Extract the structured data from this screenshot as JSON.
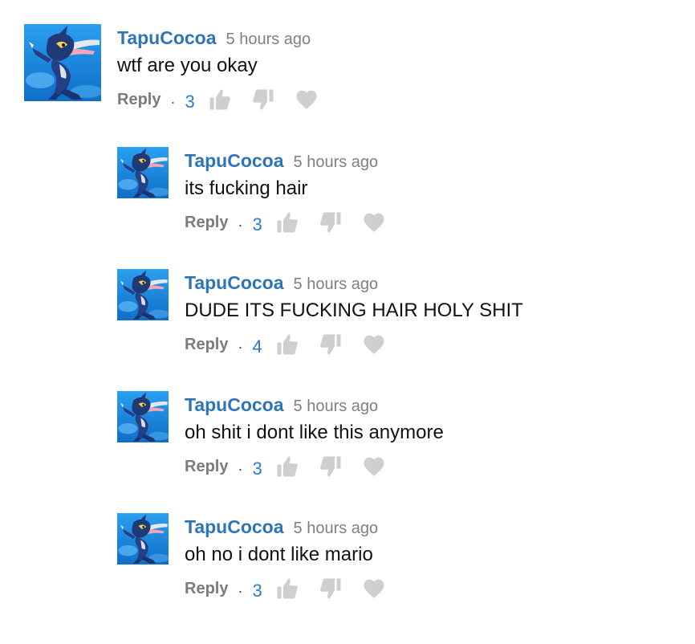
{
  "comments": [
    {
      "author": "TapuCocoa",
      "time": "5 hours ago",
      "text": "wtf are you okay",
      "reply_label": "Reply",
      "separator": "·",
      "likes": "3"
    },
    {
      "author": "TapuCocoa",
      "time": "5 hours ago",
      "text": "its fucking hair",
      "reply_label": "Reply",
      "separator": "·",
      "likes": "3"
    },
    {
      "author": "TapuCocoa",
      "time": "5 hours ago",
      "text": "DUDE ITS FUCKING HAIR HOLY SHIT",
      "reply_label": "Reply",
      "separator": "·",
      "likes": "4"
    },
    {
      "author": "TapuCocoa",
      "time": "5 hours ago",
      "text": "oh shit i dont like this anymore",
      "reply_label": "Reply",
      "separator": "·",
      "likes": "3"
    },
    {
      "author": "TapuCocoa",
      "time": "5 hours ago",
      "text": "oh no i dont like mario",
      "reply_label": "Reply",
      "separator": "·",
      "likes": "3"
    }
  ],
  "icons": {
    "like": "thumbs-up-icon",
    "dislike": "thumbs-down-icon",
    "heart": "heart-icon"
  },
  "colors": {
    "author": "#2e74b7",
    "time": "#808080",
    "like_count": "#2e78c8",
    "icon_gray": "#cfcfcf",
    "avatar_bg": "#1d8fe0"
  }
}
